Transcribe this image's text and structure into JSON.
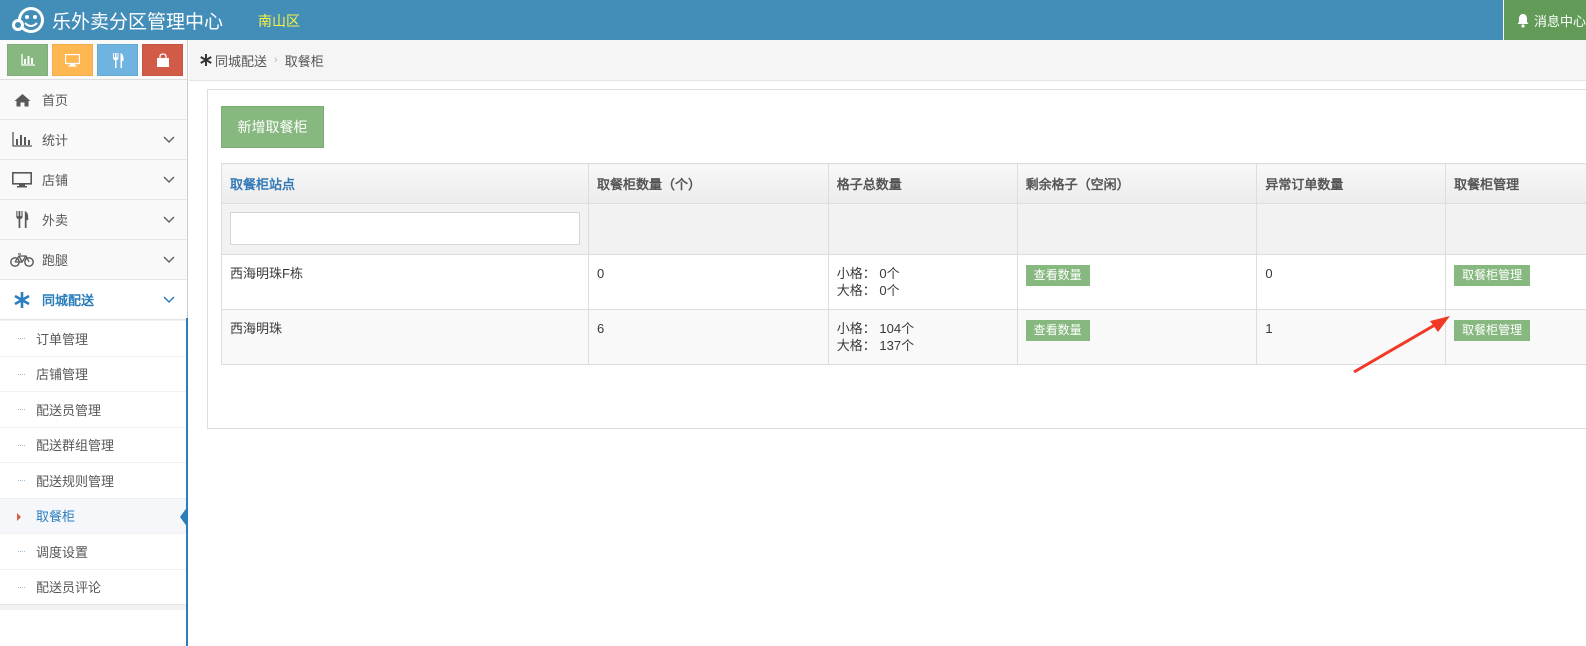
{
  "header": {
    "title": "乐外卖分区管理中心",
    "region": "南山区",
    "message_label": "消息中心"
  },
  "colors": {
    "topbar": "#438eb9",
    "accent_green": "#87b87f",
    "link_blue": "#2b7dbc",
    "alert_red": "#dd5a43"
  },
  "shortcuts": [
    {
      "name": "stats",
      "icon": "bar-chart-icon"
    },
    {
      "name": "desktop",
      "icon": "desktop-icon"
    },
    {
      "name": "food",
      "icon": "cutlery-icon"
    },
    {
      "name": "shop",
      "icon": "shopping-bag-icon"
    }
  ],
  "sidebar": {
    "items": [
      {
        "label": "首页",
        "icon": "home-icon"
      },
      {
        "label": "统计",
        "icon": "bar-chart-icon"
      },
      {
        "label": "店铺",
        "icon": "desktop-icon"
      },
      {
        "label": "外卖",
        "icon": "cutlery-icon"
      },
      {
        "label": "跑腿",
        "icon": "bicycle-icon"
      },
      {
        "label": "同城配送",
        "icon": "asterisk-icon"
      }
    ],
    "submenu": [
      "订单管理",
      "店铺管理",
      "配送员管理",
      "配送群组管理",
      "配送规则管理",
      "取餐柜",
      "调度设置",
      "配送员评论"
    ]
  },
  "breadcrumb": {
    "parent": "同城配送",
    "current": "取餐柜"
  },
  "main": {
    "add_button": "新增取餐柜",
    "columns": [
      "取餐柜站点",
      "取餐柜数量（个）",
      "格子总数量",
      "剩余格子（空闲）",
      "异常订单数量",
      "取餐柜管理"
    ],
    "rows": [
      {
        "site": "西海明珠F栋",
        "count": "0",
        "small": "小格： 0个",
        "large": "大格： 0个",
        "check_label": "查看数量",
        "abnormal": "0",
        "manage_label": "取餐柜管理"
      },
      {
        "site": "西海明珠",
        "count": "6",
        "small": "小格： 104个",
        "large": "大格： 137个",
        "check_label": "查看数量",
        "abnormal": "1",
        "manage_label": "取餐柜管理"
      }
    ]
  }
}
